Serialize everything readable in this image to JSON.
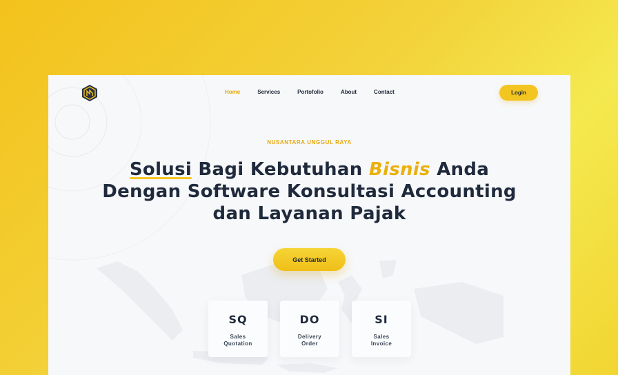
{
  "brand": {
    "logo_icon": "hexagon-logo-icon",
    "accent": "#f2c521"
  },
  "nav": {
    "items": [
      {
        "label": "Home",
        "active": true
      },
      {
        "label": "Services",
        "active": false
      },
      {
        "label": "Portofolio",
        "active": false
      },
      {
        "label": "About",
        "active": false
      },
      {
        "label": "Contact",
        "active": false
      }
    ],
    "login_label": "Login"
  },
  "hero": {
    "eyebrow": "NUSANTARA UNGGUL RAYA",
    "headline": {
      "underlined": "Solusi",
      "part1": " Bagi Kebutuhan ",
      "accent": "Bisnis",
      "part2": " Anda",
      "line2": "Dengan Software Konsultasi Accounting",
      "line3": "dan Layanan Pajak"
    },
    "cta_label": "Get Started"
  },
  "cards": [
    {
      "abbr": "SQ",
      "line1": "Sales",
      "line2": "Quotation"
    },
    {
      "abbr": "DO",
      "line1": "Delivery",
      "line2": "Order"
    },
    {
      "abbr": "SI",
      "line1": "Sales",
      "line2": "Invoice"
    }
  ]
}
